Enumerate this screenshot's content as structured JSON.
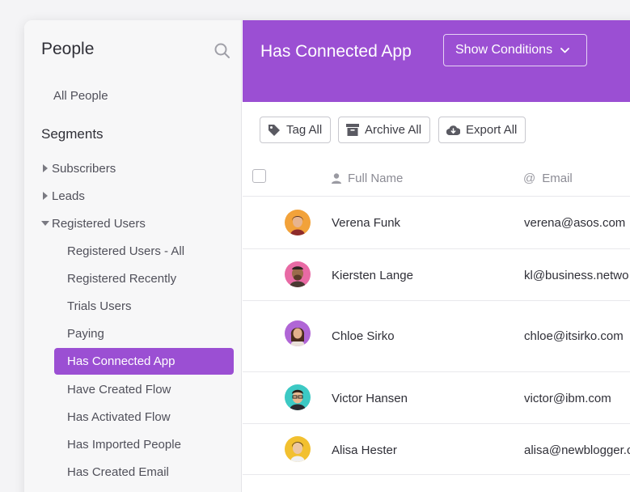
{
  "sidebar": {
    "title": "People",
    "all_people": "All People",
    "segments_heading": "Segments",
    "groups": [
      {
        "label": "Subscribers",
        "expanded": false
      },
      {
        "label": "Leads",
        "expanded": false
      },
      {
        "label": "Registered Users",
        "expanded": true
      }
    ],
    "sub_items": [
      {
        "label": "Registered Users - All"
      },
      {
        "label": "Registered Recently"
      },
      {
        "label": "Trials Users"
      },
      {
        "label": "Paying"
      },
      {
        "label": "Has Connected App",
        "active": true
      },
      {
        "label": "Have Created Flow"
      },
      {
        "label": "Has Activated Flow"
      },
      {
        "label": "Has Imported People"
      },
      {
        "label": "Has Created Email"
      }
    ]
  },
  "header": {
    "title": "Has Connected App",
    "conditions_button": "Show Conditions"
  },
  "toolbar": {
    "tag_all": "Tag All",
    "archive_all": "Archive All",
    "export_all": "Export All"
  },
  "table": {
    "columns": {
      "name": "Full Name",
      "email": "Email"
    },
    "rows": [
      {
        "name": "Verena Funk",
        "email": "verena@asos.com"
      },
      {
        "name": "Kiersten Lange",
        "email": "kl@business.netwo"
      },
      {
        "name": "Chloe Sirko",
        "email": "chloe@itsirko.com"
      },
      {
        "name": "Victor Hansen",
        "email": "victor@ibm.com"
      },
      {
        "name": "Alisa Hester",
        "email": "alisa@newblogger.com"
      }
    ]
  },
  "colors": {
    "accent": "#9b4fd3",
    "sidebar_bg": "#f7f7f8"
  }
}
